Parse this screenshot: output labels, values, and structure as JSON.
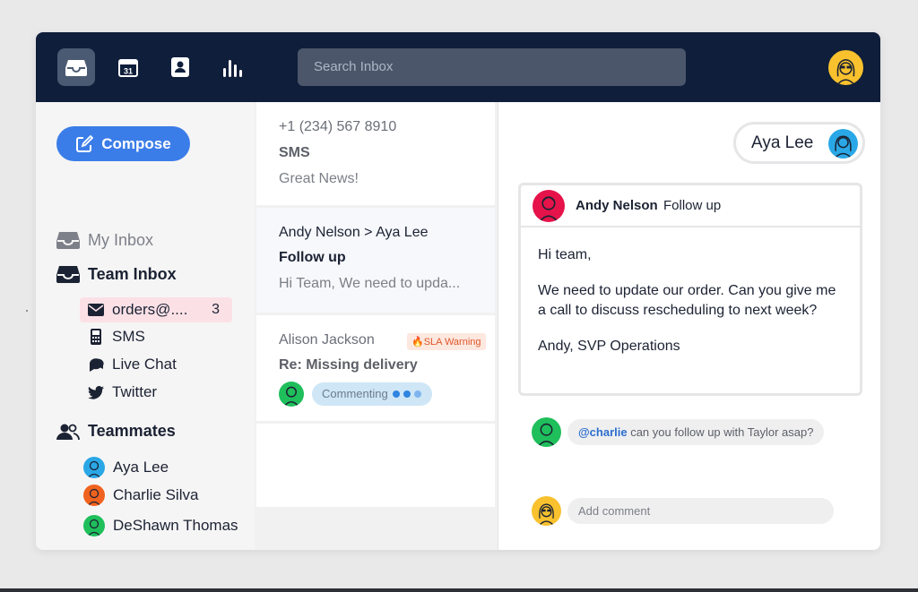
{
  "search": {
    "placeholder": "Search Inbox"
  },
  "nav": {
    "calendar_day": "31"
  },
  "sidebar": {
    "compose_label": "Compose",
    "my_inbox": "My Inbox",
    "team_inbox": "Team Inbox",
    "channels": [
      {
        "label": "orders@....",
        "count": "3",
        "icon": "envelope-icon",
        "selected": true
      },
      {
        "label": "SMS",
        "icon": "phone-icon"
      },
      {
        "label": "Live Chat",
        "icon": "chat-bubbles-icon"
      },
      {
        "label": "Twitter",
        "icon": "twitter-icon"
      }
    ],
    "teammates_heading": "Teammates",
    "teammates": [
      {
        "name": "Aya Lee",
        "color": "#2aa7e6"
      },
      {
        "name": "Charlie Silva",
        "color": "#f0621f"
      },
      {
        "name": "DeShawn Thomas",
        "color": "#1fbf5c"
      }
    ]
  },
  "conversations": [
    {
      "from": "+1 (234) 567 8910",
      "subject": "SMS",
      "preview": "Great News!"
    },
    {
      "from": "Andy Nelson > Aya Lee",
      "subject": "Follow up",
      "preview": "Hi Team, We need to upda..."
    },
    {
      "from": "Alison Jackson",
      "subject": "Re: Missing delivery",
      "badge": "SLA Warning",
      "status": "Commenting"
    }
  ],
  "detail": {
    "contact_name": "Aya Lee",
    "message": {
      "from": "Andy Nelson",
      "subject": "Follow up",
      "greeting": "Hi team,",
      "body": "We need to update our order. Can you give me a call to discuss rescheduling to next week?",
      "signature": "Andy, SVP Operations"
    },
    "comment": {
      "mention": "@charlie",
      "text": " can you follow up with Taylor asap?"
    },
    "add_comment_placeholder": "Add comment"
  },
  "colors": {
    "topbar": "#0f1e3a",
    "accent": "#3b7de8",
    "andy_avatar": "#e5134a",
    "user_avatar": "#f8c12d",
    "sla_warning": "#e0562a"
  }
}
